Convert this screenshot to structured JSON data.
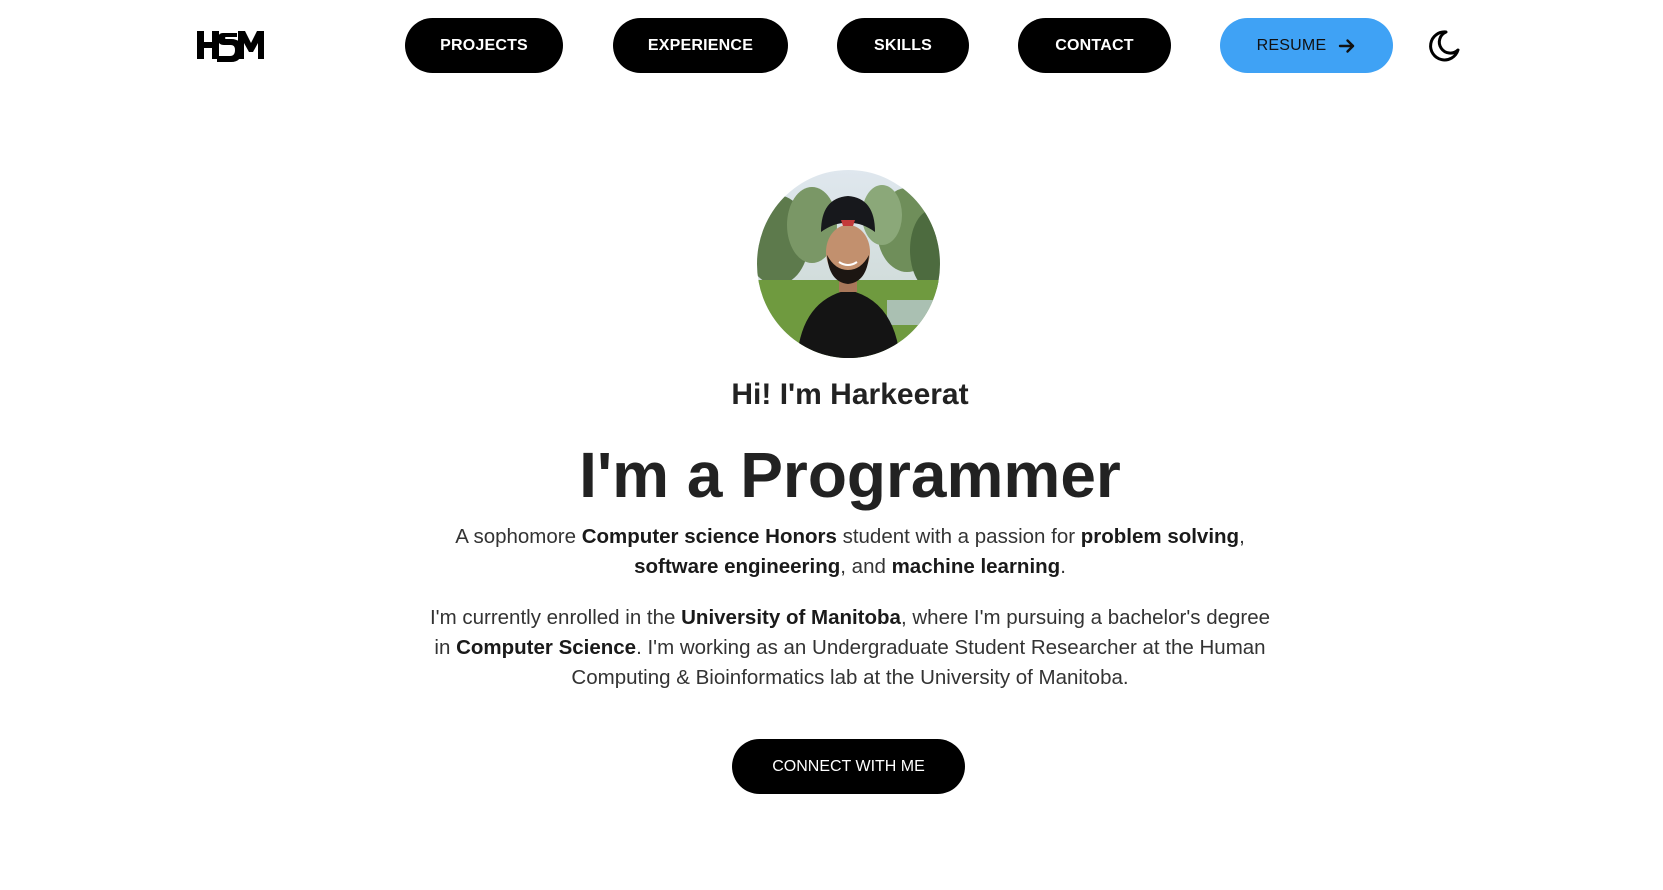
{
  "nav": {
    "logo_text": "HSM",
    "items": [
      {
        "label": "PROJECTS"
      },
      {
        "label": "EXPERIENCE"
      },
      {
        "label": "SKILLS"
      },
      {
        "label": "CONTACT"
      }
    ],
    "resume_label": "RESUME",
    "resume_icon": "arrow-right-icon",
    "theme_icon": "moon-icon",
    "resume_color": "#3fa2f5"
  },
  "hero": {
    "avatar_icon": "profile-photo",
    "greeting": "Hi! I'm Harkeerat",
    "headline": "I'm a Programmer",
    "intro": {
      "t1": "A sophomore ",
      "b1": "Computer science Honors",
      "t2": " student with a passion for ",
      "b2": "problem solving",
      "t3": ",",
      "b3": "software engineering",
      "t4": ", and ",
      "b4": "machine learning",
      "t5": "."
    },
    "bio": {
      "t1": "I'm currently enrolled in the ",
      "b1": "University of Manitoba",
      "t2": ", where I'm pursuing a bachelor's degree",
      "t3": "in ",
      "b2": "Computer Science",
      "t4": ". I'm working as an Undergraduate Student Researcher at the Human",
      "t5": "Computing & Bioinformatics lab at the University of Manitoba."
    },
    "cta_label": "CONNECT WITH ME"
  }
}
